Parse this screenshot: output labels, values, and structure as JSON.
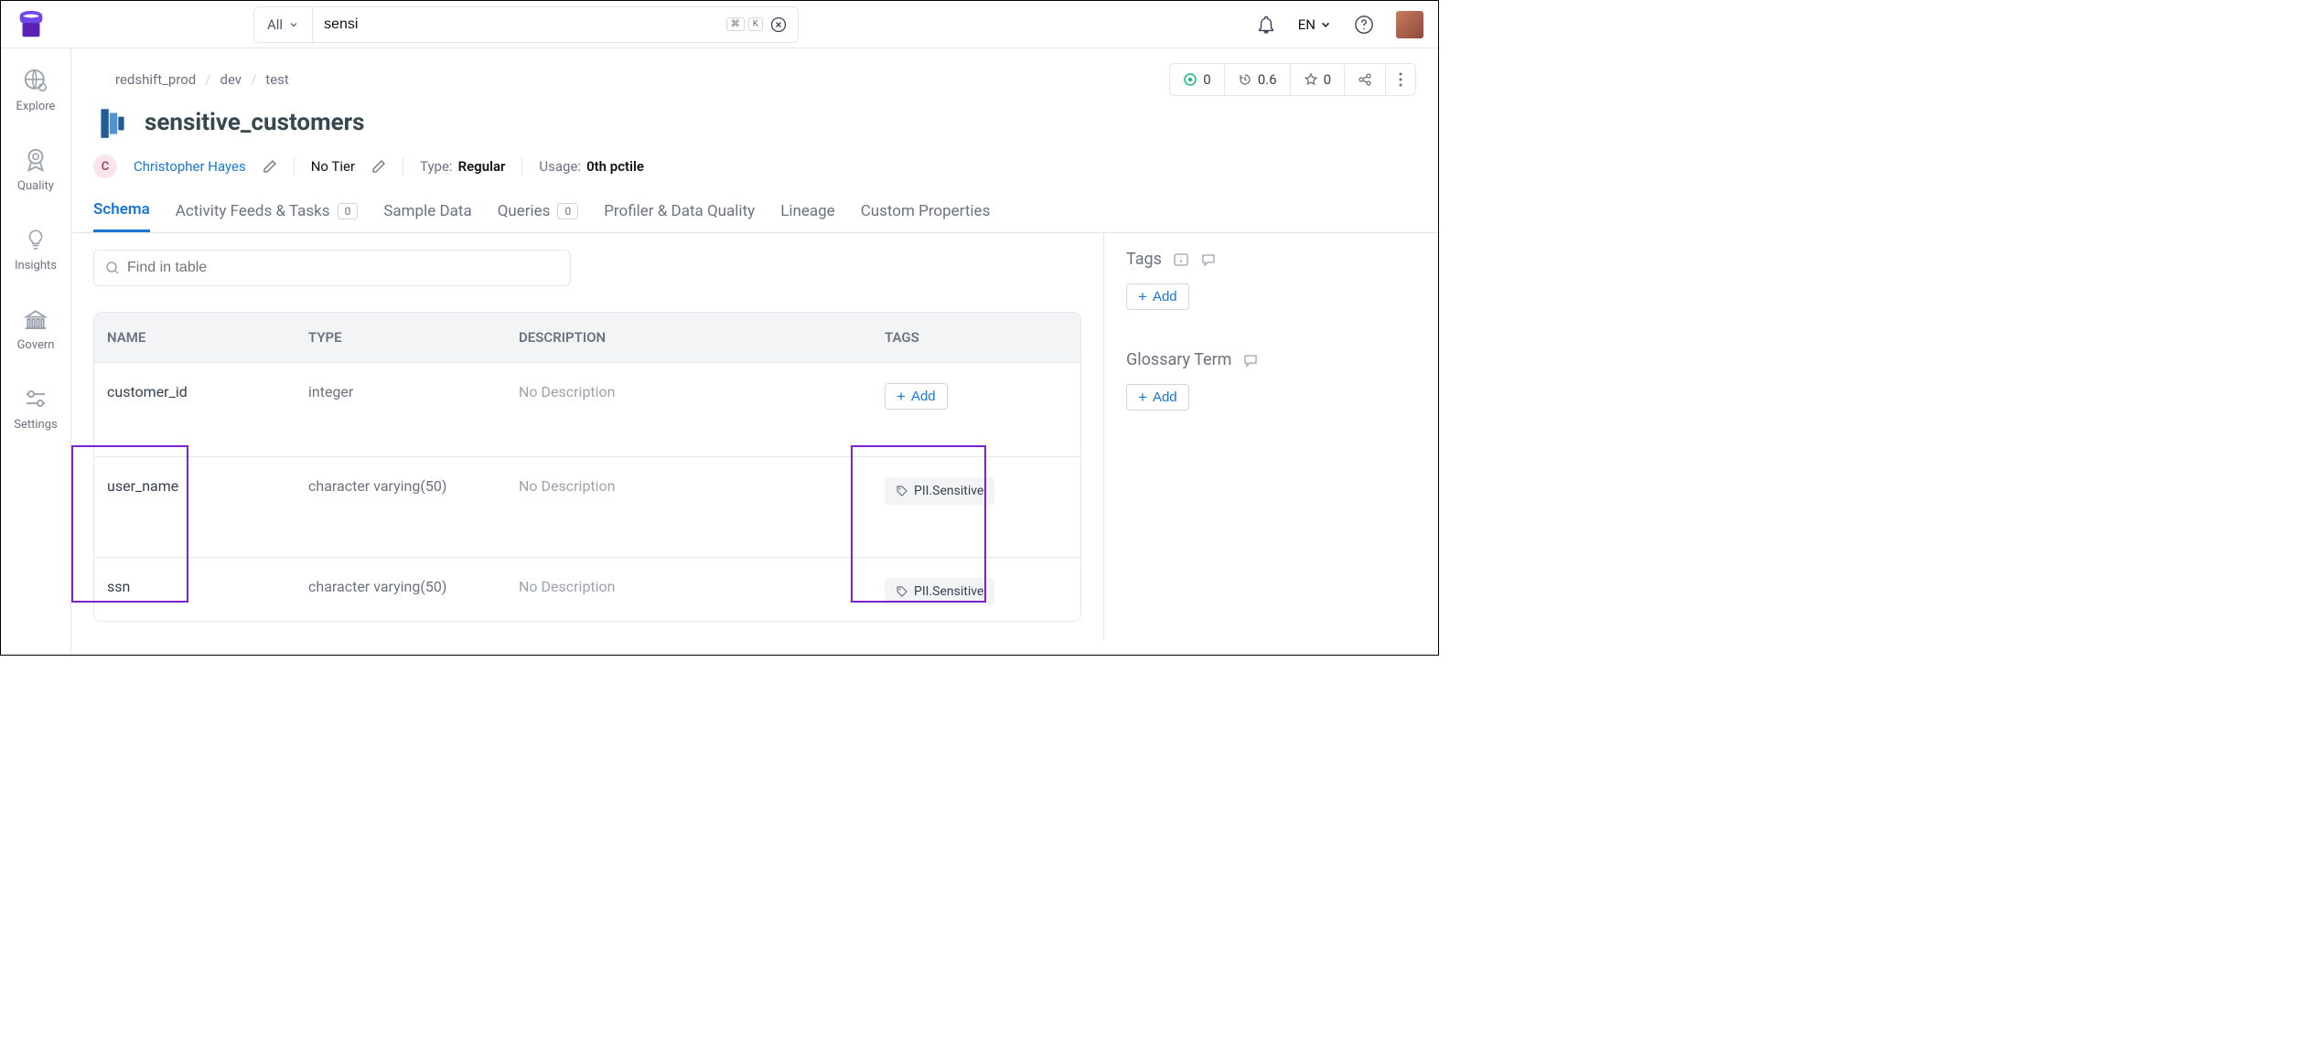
{
  "search": {
    "filter_label": "All",
    "value": "sensi",
    "kbd1": "⌘",
    "kbd2": "K"
  },
  "header": {
    "language": "EN"
  },
  "sidebar": {
    "items": [
      {
        "label": "Explore"
      },
      {
        "label": "Quality"
      },
      {
        "label": "Insights"
      },
      {
        "label": "Govern"
      },
      {
        "label": "Settings"
      }
    ]
  },
  "breadcrumb": [
    "redshift_prod",
    "dev",
    "test"
  ],
  "stats": {
    "alerts": "0",
    "version": "0.6",
    "stars": "0"
  },
  "page": {
    "title": "sensitive_customers"
  },
  "meta": {
    "owner_initial": "C",
    "owner_name": "Christopher Hayes",
    "tier_label": "No Tier",
    "type_label": "Type:",
    "type_value": "Regular",
    "usage_label": "Usage:",
    "usage_value": "0th pctile"
  },
  "tabs": {
    "schema": "Schema",
    "activity": "Activity Feeds & Tasks",
    "activity_count": "0",
    "sample": "Sample Data",
    "queries": "Queries",
    "queries_count": "0",
    "profiler": "Profiler & Data Quality",
    "lineage": "Lineage",
    "custom": "Custom Properties"
  },
  "find_placeholder": "Find in table",
  "table": {
    "headers": {
      "name": "NAME",
      "type": "TYPE",
      "description": "DESCRIPTION",
      "tags": "TAGS"
    },
    "rows": [
      {
        "name": "customer_id",
        "type": "integer",
        "desc": "No Description",
        "tag": null
      },
      {
        "name": "user_name",
        "type": "character varying(50)",
        "desc": "No Description",
        "tag": "PII.Sensitive"
      },
      {
        "name": "ssn",
        "type": "character varying(50)",
        "desc": "No Description",
        "tag": "PII.Sensitive"
      }
    ]
  },
  "buttons": {
    "add": "Add"
  },
  "side": {
    "tags_title": "Tags",
    "glossary_title": "Glossary Term"
  }
}
